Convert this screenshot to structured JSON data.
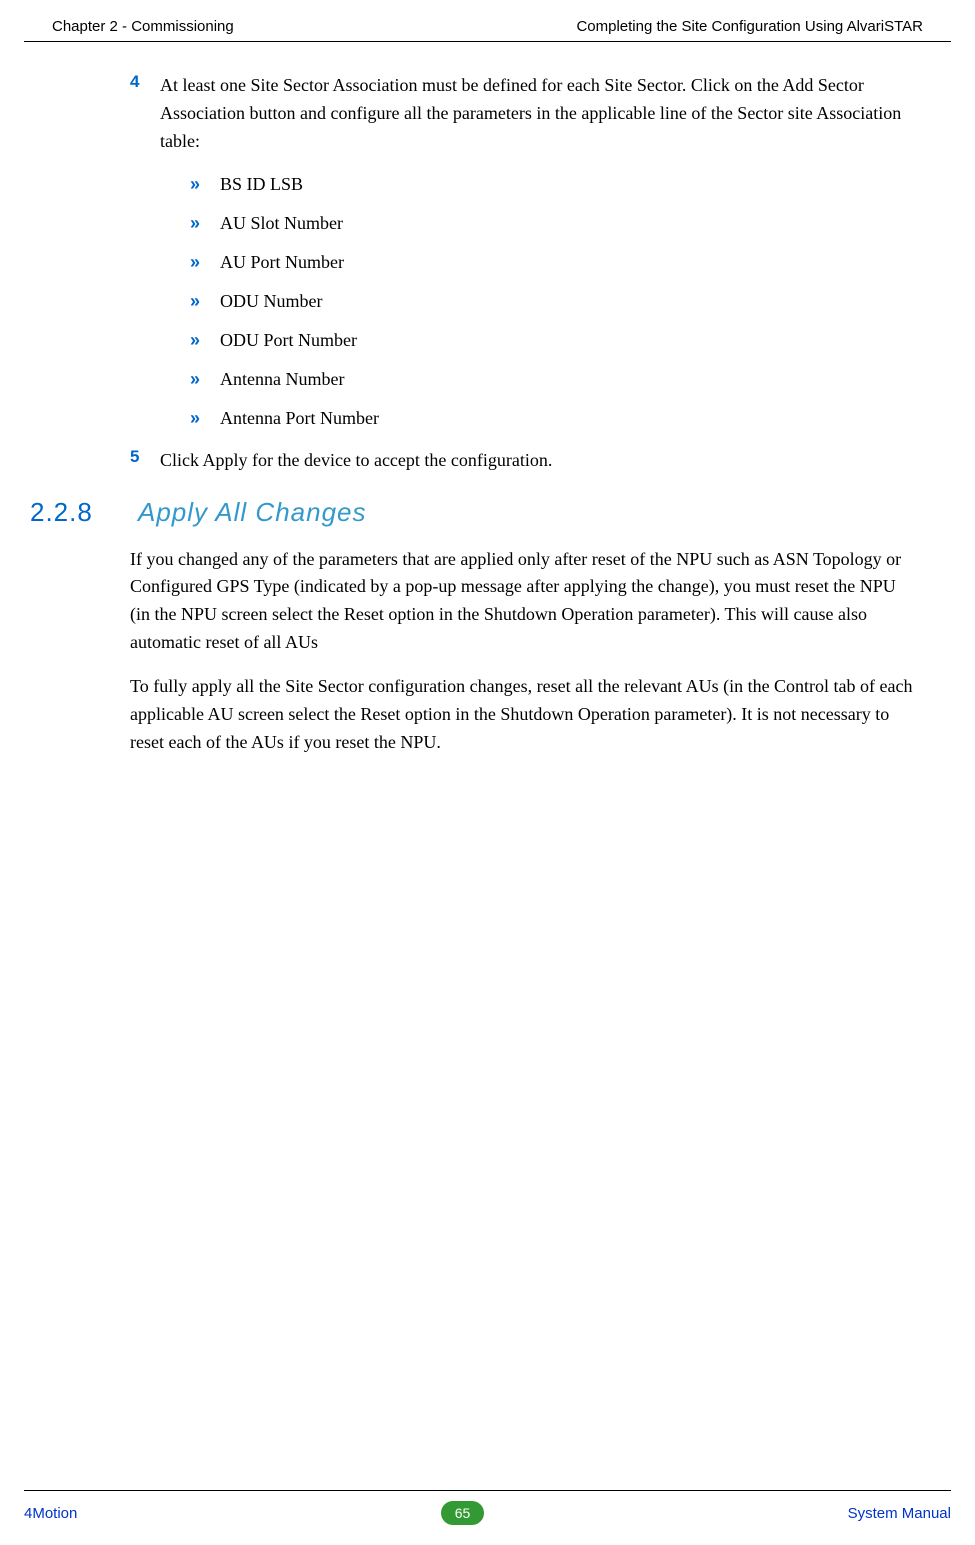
{
  "header": {
    "left": "Chapter 2 - Commissioning",
    "right": "Completing the Site Configuration Using AlvariSTAR"
  },
  "step4": {
    "num": "4",
    "text": "At least one Site Sector Association must be defined for each Site Sector. Click on the Add Sector Association button and configure all the parameters in the applicable line of the Sector site Association table:"
  },
  "sub_items": [
    "BS ID LSB",
    "AU Slot Number",
    "AU Port Number",
    "ODU Number",
    "ODU Port Number",
    "Antenna Number",
    "Antenna Port Number"
  ],
  "step5": {
    "num": "5",
    "text": "Click Apply for the device to accept the configuration."
  },
  "section": {
    "num": "2.2.8",
    "title": "Apply All Changes"
  },
  "para1": "If you changed any of the parameters that are applied only after reset of the NPU such as ASN Topology or Configured GPS Type (indicated by a pop-up message after applying the change), you must reset the NPU (in the NPU screen select the Reset option in the Shutdown Operation parameter). This will cause also automatic reset of all AUs",
  "para2": "To fully apply all the Site Sector configuration changes, reset all the relevant AUs (in the Control tab of each applicable AU screen select the Reset option in the Shutdown Operation parameter). It is not necessary to reset each of the AUs if you reset the NPU.",
  "footer": {
    "left": "4Motion",
    "page": "65",
    "right": "System Manual"
  },
  "sub_marker": "»"
}
